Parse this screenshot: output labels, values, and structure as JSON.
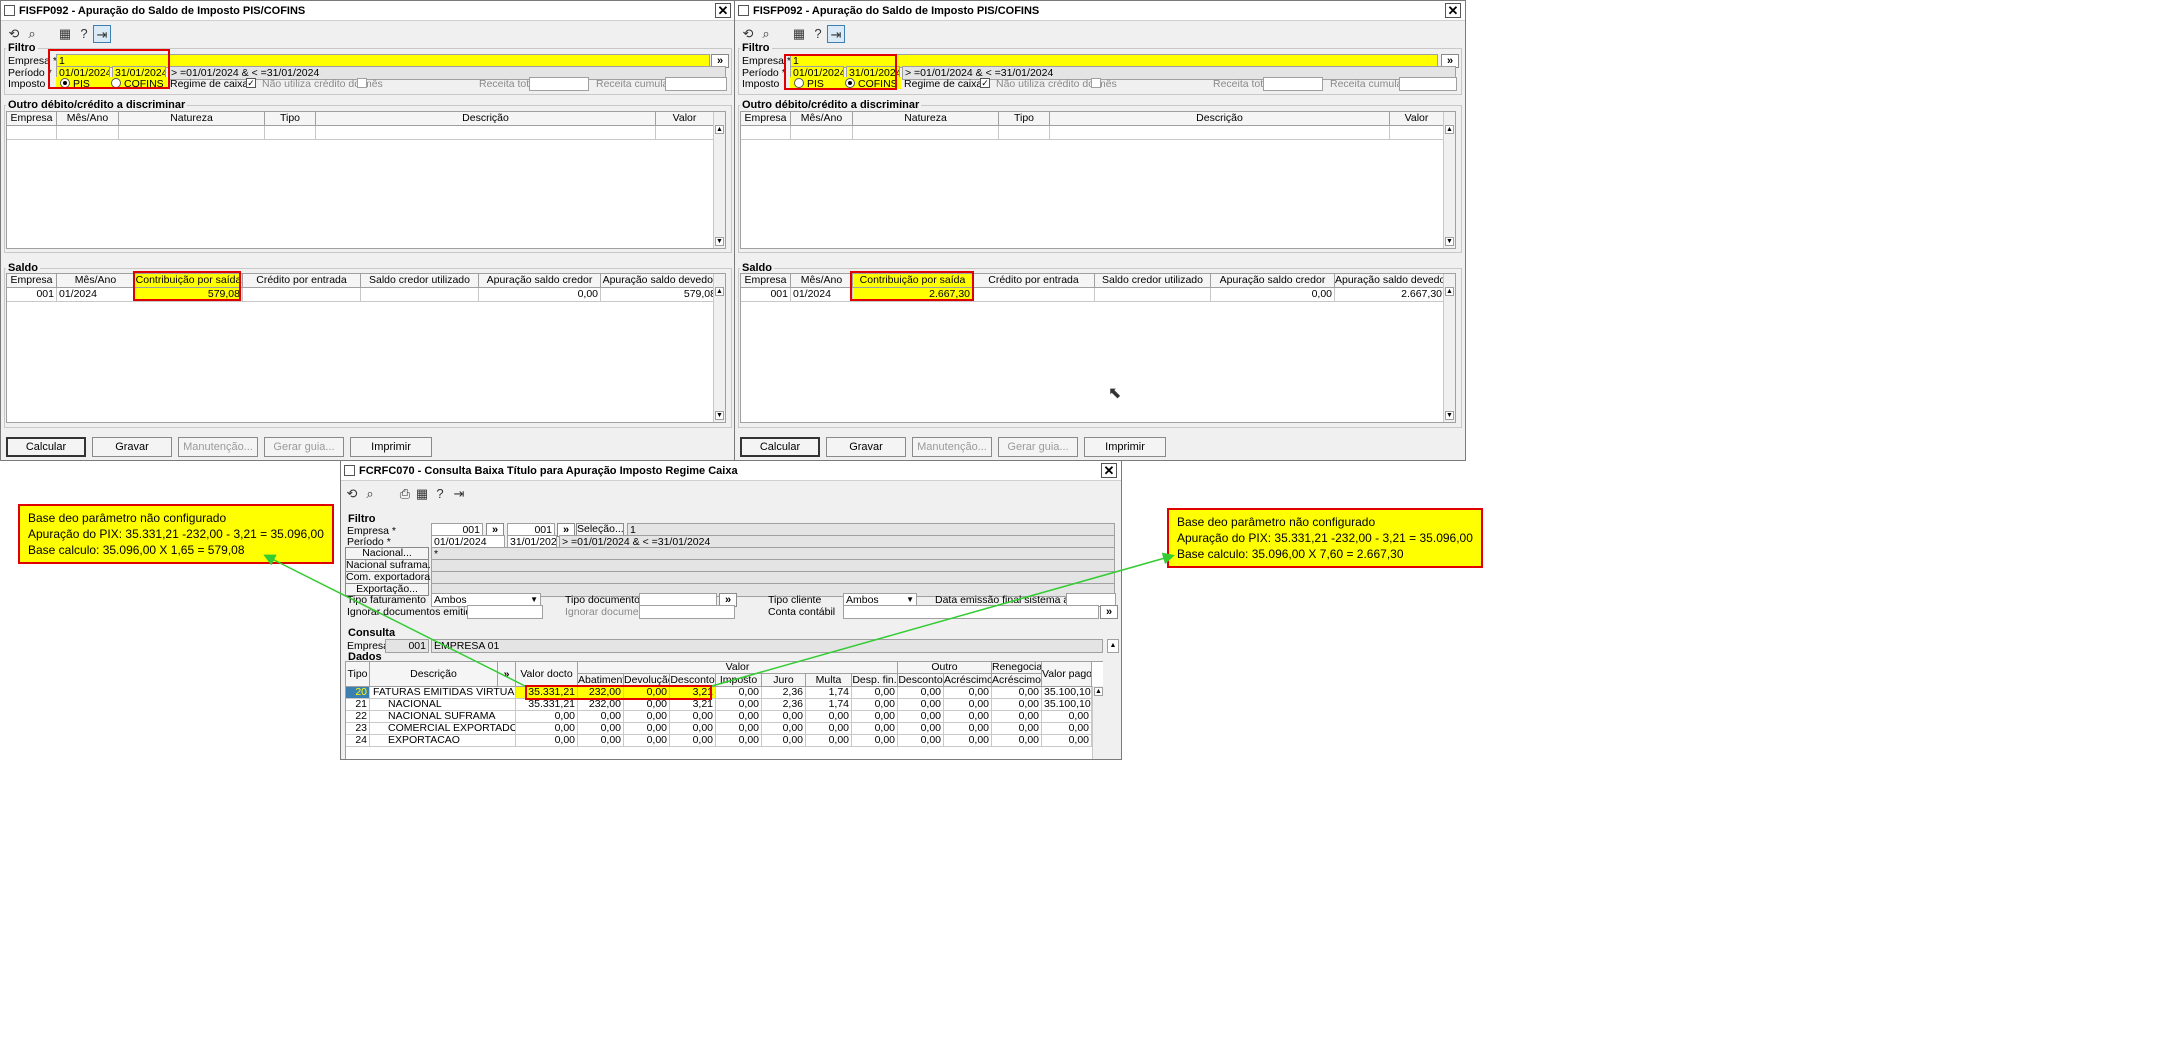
{
  "win1": {
    "title": "FISFP092 - Apuração do Saldo de Imposto PIS/COFINS",
    "filtro_label": "Filtro",
    "empresa_label": "Empresa *",
    "empresa_value": "1",
    "periodo_label": "Período *",
    "periodo_de": "01/01/2024",
    "periodo_ate": "31/01/2024",
    "periodo_expr": "> =01/01/2024 & < =31/01/2024",
    "imposto_label": "Imposto",
    "pis_label": "PIS",
    "cofins_label": "COFINS",
    "selected_imposto": "PIS",
    "regime_label": "Regime de caixa",
    "nao_utiliza_label": "Não utiliza crédito do mês",
    "receita_total_label": "Receita total",
    "receita_cumulativa_label": "Receita cumulativa",
    "outro_label": "Outro débito/crédito a discriminar",
    "outro_headers": [
      "Empresa",
      "Mês/Ano",
      "Natureza",
      "Tipo",
      "Descrição",
      "Valor"
    ],
    "saldo_label": "Saldo",
    "saldo_headers": [
      "Empresa",
      "Mês/Ano",
      "Contribuição por saída",
      "Crédito por entrada",
      "Saldo credor utilizado",
      "Apuração saldo credor",
      "Apuração saldo devedor"
    ],
    "saldo_row": [
      "001",
      "01/2024",
      "579,08",
      "",
      "",
      "0,00",
      "579,08"
    ],
    "buttons": [
      "Calcular",
      "Gravar",
      "Manutenção...",
      "Gerar guia...",
      "Imprimir"
    ]
  },
  "win2": {
    "title": "FISFP092 - Apuração do Saldo de Imposto PIS/COFINS",
    "filtro_label": "Filtro",
    "empresa_label": "Empresa *",
    "empresa_value": "1",
    "periodo_label": "Período *",
    "periodo_de": "01/01/2024",
    "periodo_ate": "31/01/2024",
    "periodo_expr": "> =01/01/2024 & < =31/01/2024",
    "imposto_label": "Imposto",
    "pis_label": "PIS",
    "cofins_label": "COFINS",
    "selected_imposto": "COFINS",
    "regime_label": "Regime de caixa",
    "nao_utiliza_label": "Não utiliza crédito do mês",
    "receita_total_label": "Receita total",
    "receita_cumulativa_label": "Receita cumulativa",
    "outro_label": "Outro débito/crédito a discriminar",
    "outro_headers": [
      "Empresa",
      "Mês/Ano",
      "Natureza",
      "Tipo",
      "Descrição",
      "Valor"
    ],
    "saldo_label": "Saldo",
    "saldo_headers": [
      "Empresa",
      "Mês/Ano",
      "Contribuição por saída",
      "Crédito por entrada",
      "Saldo credor utilizado",
      "Apuração saldo credor",
      "Apuração saldo devedor"
    ],
    "saldo_row": [
      "001",
      "01/2024",
      "2.667,30",
      "",
      "",
      "0,00",
      "2.667,30"
    ],
    "buttons": [
      "Calcular",
      "Gravar",
      "Manutenção...",
      "Gerar guia...",
      "Imprimir"
    ]
  },
  "win3": {
    "title": "FCRFC070 - Consulta Baixa Título para Apuração Imposto Regime Caixa",
    "filtro_label": "Filtro",
    "empresa_label": "Empresa *",
    "empresa_de": "001",
    "empresa_ate": "001",
    "selecao_label": "Seleção...",
    "selecao_value": "1",
    "periodo_label": "Período *",
    "periodo_de": "01/01/2024",
    "periodo_ate": "31/01/2024",
    "periodo_expr": "> =01/01/2024 & < =31/01/2024",
    "nacional_btn": "Nacional...",
    "nacional_value": "*",
    "suframa_btn": "Nacional suframa...",
    "comexp_btn": "Com. exportadora...",
    "exportacao_btn": "Exportação...",
    "tipo_fat_label": "Tipo faturamento",
    "tipo_fat_value": "Ambos",
    "tipo_doc_label": "Tipo documento",
    "tipo_cliente_label": "Tipo cliente",
    "tipo_cliente_value": "Ambos",
    "data_emissao_label": "Data emissão final sistema anterior",
    "ignorar_emitidos_label": "Ignorar documentos emitidos até",
    "ignorar_doc_label": "Ignorar documento",
    "conta_contabil_label": "Conta contábil",
    "consulta_label": "Consulta",
    "consulta_empresa_label": "Empresa",
    "consulta_empresa_code": "001",
    "consulta_empresa_name": "EMPRESA 01",
    "dados_label": "Dados",
    "group_headers": {
      "valor": "Valor",
      "outro": "Outro",
      "renegociacao": "Renegociação"
    },
    "headers": [
      "Tipo",
      "Descrição",
      "Valor docto",
      "Abatimento",
      "Devolução",
      "Desconto",
      "Imposto",
      "Juro",
      "Multa",
      "Desp. fin.",
      "Desconto",
      "Acréscimo",
      "Acréscimo",
      "Valor pago"
    ],
    "rows": [
      [
        "20",
        "FATURAS EMITIDAS VIRTUALAGE",
        "35.331,21",
        "232,00",
        "0,00",
        "3,21",
        "0,00",
        "2,36",
        "1,74",
        "0,00",
        "0,00",
        "0,00",
        "0,00",
        "35.100,10"
      ],
      [
        "21",
        "NACIONAL",
        "35.331,21",
        "232,00",
        "0,00",
        "3,21",
        "0,00",
        "2,36",
        "1,74",
        "0,00",
        "0,00",
        "0,00",
        "0,00",
        "35.100,10"
      ],
      [
        "22",
        "NACIONAL SUFRAMA",
        "0,00",
        "0,00",
        "0,00",
        "0,00",
        "0,00",
        "0,00",
        "0,00",
        "0,00",
        "0,00",
        "0,00",
        "0,00",
        "0,00"
      ],
      [
        "23",
        "COMERCIAL EXPORTADORA",
        "0,00",
        "0,00",
        "0,00",
        "0,00",
        "0,00",
        "0,00",
        "0,00",
        "0,00",
        "0,00",
        "0,00",
        "0,00",
        "0,00"
      ],
      [
        "24",
        "EXPORTACAO",
        "0,00",
        "0,00",
        "0,00",
        "0,00",
        "0,00",
        "0,00",
        "0,00",
        "0,00",
        "0,00",
        "0,00",
        "0,00",
        "0,00"
      ]
    ]
  },
  "note_left": {
    "line1": "Base deo parâmetro não configurado",
    "line2": "Apuração do PIX: 35.331,21 -232,00 - 3,21 = 35.096,00",
    "line3": "Base calculo: 35.096,00 X 1,65 = 579,08"
  },
  "note_right": {
    "line1": "Base deo parâmetro não configurado",
    "line2": "Apuração do PIX: 35.331,21 -232,00 - 3,21 = 35.096,00",
    "line3": "Base calculo: 35.096,00 X 7,60 = 2.667,30"
  },
  "colors": {
    "highlight": "#ffff00",
    "box": "#e00000",
    "arrow": "#33cc33"
  },
  "icons": [
    "refresh-icon",
    "search-icon",
    "calendar-icon",
    "help-icon",
    "exit-icon",
    "print-icon",
    "close-icon",
    "mouse-cursor-icon"
  ]
}
